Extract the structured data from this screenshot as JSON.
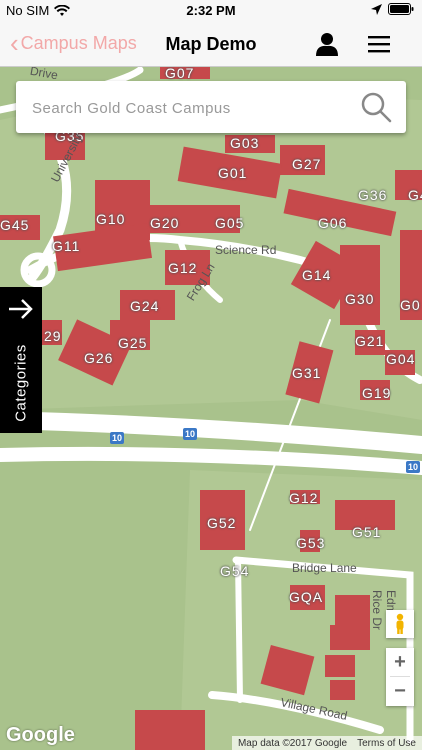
{
  "status": {
    "carrier": "No SIM",
    "time": "2:32 PM"
  },
  "nav": {
    "back_label": "Campus Maps",
    "title": "Map Demo"
  },
  "search": {
    "placeholder": "Search Gold Coast Campus"
  },
  "categories_label": "Categories",
  "map": {
    "buildings": [
      "G07",
      "G35",
      "G03",
      "G27",
      "G01",
      "G36",
      "G4",
      "G10",
      "G20",
      "G05",
      "G06",
      "G45",
      "G11",
      "G12",
      "G14",
      "G30",
      "G0",
      "G24",
      "G21",
      "G25",
      "G04",
      "G26",
      "G31",
      "G19",
      "29",
      "G12",
      "G51",
      "G52",
      "G53",
      "G54",
      "GQA"
    ],
    "roads": [
      "University Dr",
      "Drive",
      "Science Rd",
      "Frog Ln",
      "Bridge Lane",
      "Village Road",
      "Edmund Rice Dr"
    ],
    "route_shield": "10"
  },
  "zoom": {
    "in": "+",
    "out": "−"
  },
  "attribution": {
    "data": "Map data ©2017 Google",
    "terms": "Terms of Use",
    "logo": "Google"
  },
  "colors": {
    "building": "#c6494b",
    "grass": "#a9c28c",
    "road": "#ffffff",
    "back": "#f2a8a8"
  }
}
